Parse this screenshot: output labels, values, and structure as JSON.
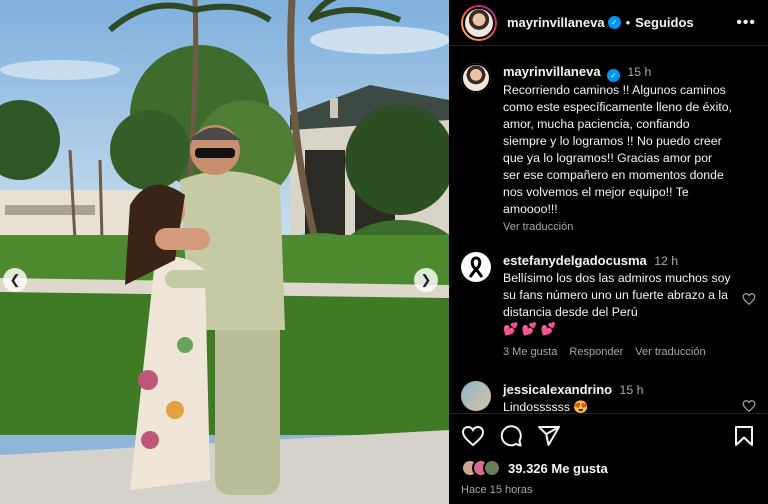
{
  "post": {
    "author": "mayrinvillaneva",
    "follow_state": "Seguidos",
    "caption_time": "15 h",
    "caption": "Recorriendo caminos !! Algunos caminos como este específicamente lleno de éxito, amor, mucha paciencia, confiando siempre y lo logramos !! No puedo creer que ya lo logramos!! Gracias amor por ser ese compañero en momentos donde nos volvemos el mejor equipo!! Te amoooo!!!",
    "translate_label": "Ver traducción"
  },
  "comments": [
    {
      "user": "estefanydelgadocusma",
      "time": "12 h",
      "text": "Bellísimo los dos las admiros muchos soy su fans número uno un fuerte abrazo a la distancia desde del Perú",
      "emoji": "💕 💕 💕",
      "likes": "3 Me gusta",
      "reply": "Responder",
      "translate": "Ver traducción"
    },
    {
      "user": "jessicalexandrino",
      "time": "15 h",
      "text": "Lindossssss",
      "emoji": "😍"
    }
  ],
  "stats": {
    "likes": "39.326 Me gusta",
    "time_ago": "Hace 15 horas"
  },
  "icons": {
    "more": "more-options-icon",
    "like": "heart-icon",
    "comment": "comment-icon",
    "share": "share-icon",
    "save": "bookmark-icon",
    "verified": "verified-badge-icon"
  },
  "colors": {
    "background": "#000000",
    "verified": "#0095f6",
    "muted_text": "#a8a8a8"
  }
}
